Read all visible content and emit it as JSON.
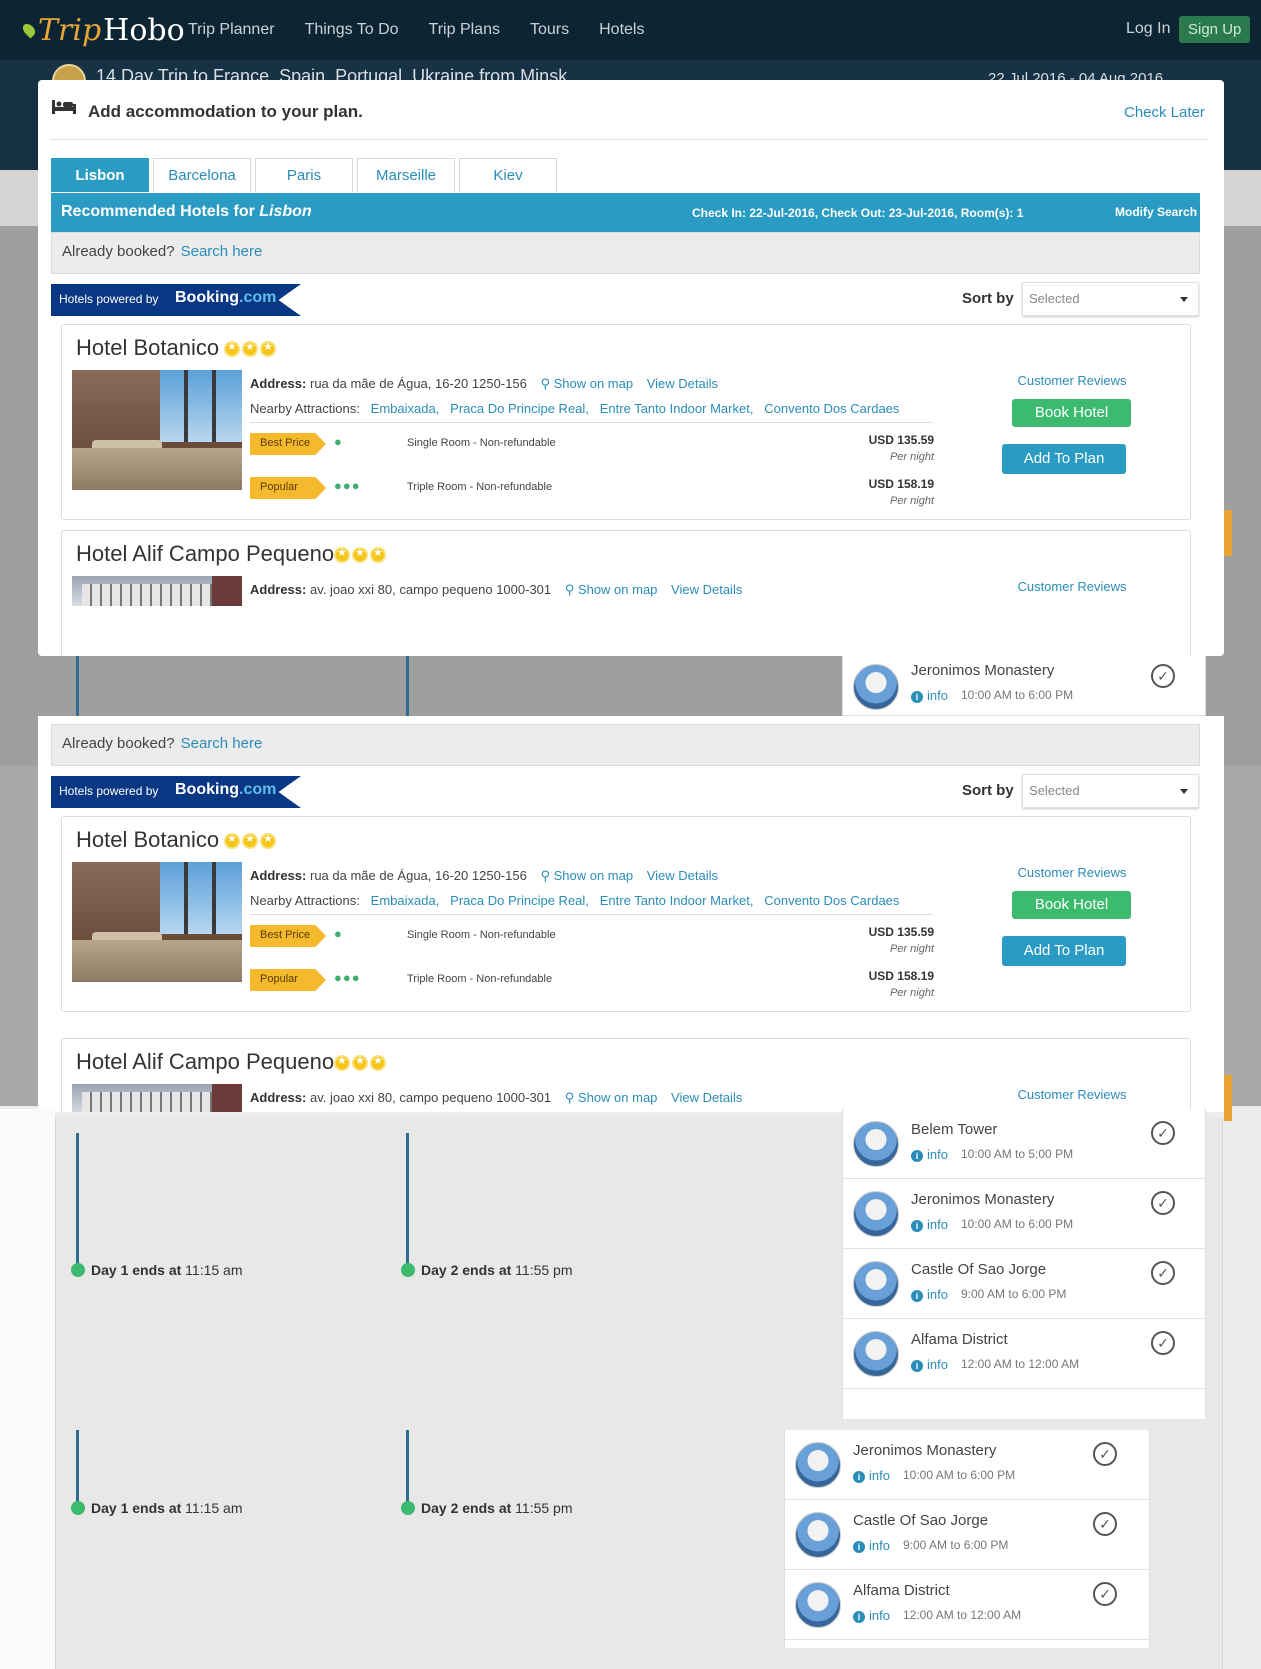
{
  "nav": {
    "logo_trip": "Trip",
    "logo_hobo": "Hobo",
    "links": [
      "Trip Planner",
      "Things To Do",
      "Trip Plans",
      "Tours",
      "Hotels"
    ],
    "login": "Log In",
    "signup": "Sign Up"
  },
  "trip": {
    "title": "14 Day Trip to France, Spain, Portugal, Ukraine from Minsk",
    "dates": "22 Jul 2016 - 04 Aug 2016"
  },
  "modal": {
    "title": "Add accommodation to your plan.",
    "check_later": "Check Later",
    "tabs": [
      "Lisbon",
      "Barcelona",
      "Paris",
      "Marseille",
      "Kiev"
    ],
    "rec_prefix": "Recommended Hotels for",
    "rec_city": "Lisbon",
    "checkin_info": "Check In: 22-Jul-2016, Check Out: 23-Jul-2016, Room(s): 1",
    "modify_search": "Modify Search",
    "already_booked": "Already booked?",
    "search_here": "Search here",
    "powered_by": "Hotels powered by",
    "booking_brand": "Booking",
    "booking_com": ".com",
    "sort_by": "Sort by",
    "sort_selected": "Selected",
    "address_label": "Address:",
    "show_on_map": "Show on map",
    "view_details": "View Details",
    "nearby_label": "Nearby Attractions:",
    "customer_reviews": "Customer Reviews",
    "book_hotel": "Book Hotel",
    "add_to_plan": "Add To Plan",
    "hotels": [
      {
        "name": "Hotel Botanico",
        "stars": 3,
        "address": "rua da mãe de Água, 16-20 1250-156",
        "nearby": [
          "Embaixada,",
          "Praca Do Principe Real,",
          "Entre Tanto Indoor Market,",
          "Convento Dos Cardaes"
        ],
        "rooms": [
          {
            "tag": "Best Price",
            "persons": "●",
            "type": "Single Room - Non-refundable",
            "price": "USD 135.59",
            "per": "Per night"
          },
          {
            "tag": "Popular",
            "persons": "●●●",
            "type": "Triple Room - Non-refundable",
            "price": "USD 158.19",
            "per": "Per night"
          }
        ]
      },
      {
        "name": "Hotel Alif Campo Pequeno",
        "stars": 3,
        "address": "av. joao xxi 80, campo pequeno 1000-301"
      }
    ]
  },
  "itinerary": {
    "day1_label": "Day 1 ends at",
    "day1_time": "11:15 am",
    "day2_label": "Day 2 ends at",
    "day2_time": "11:55 pm",
    "info": "info",
    "attractions": [
      {
        "name": "Belem Tower",
        "hours": "10:00 AM to 5:00 PM"
      },
      {
        "name": "Jeronimos Monastery",
        "hours": "10:00 AM to 6:00 PM"
      },
      {
        "name": "Castle Of Sao Jorge",
        "hours": "9:00 AM to 6:00 PM"
      },
      {
        "name": "Alfama District",
        "hours": "12:00 AM to 12:00 AM"
      }
    ]
  },
  "colors": {
    "nav_bg": "#0d2532",
    "accent": "#2a9cc4",
    "green": "#3cbb6e",
    "orange": "#f4b92c"
  }
}
